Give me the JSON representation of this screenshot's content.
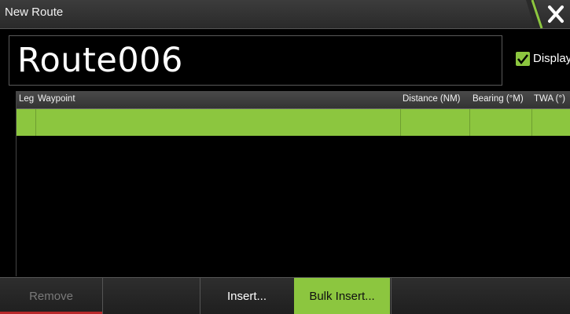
{
  "window": {
    "title": "New Route",
    "close_icon": "close-icon"
  },
  "route": {
    "name": "Route006",
    "display_label": "Display",
    "display_checked": true
  },
  "table": {
    "columns": [
      "Leg",
      "Waypoint",
      "Distance (NM)",
      "Bearing (°M)",
      "TWA (°)"
    ],
    "rows": [
      {
        "leg": "",
        "waypoint": "",
        "distance": "",
        "bearing": "",
        "twa": "",
        "selected": true
      }
    ]
  },
  "toolbar": {
    "remove_label": "Remove",
    "insert_label": "Insert...",
    "bulk_insert_label": "Bulk Insert..."
  },
  "colors": {
    "accent": "#8cc63f",
    "danger": "#b8282a",
    "background": "#000000"
  }
}
